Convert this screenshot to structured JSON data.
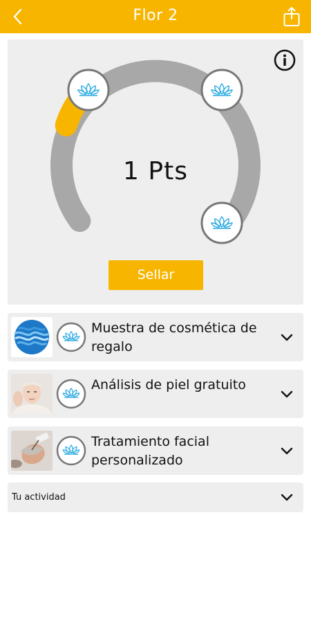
{
  "header": {
    "title": "Flor 2",
    "back_icon": "chevron-left-icon",
    "share_icon": "share-icon",
    "background_color": "#f7b500"
  },
  "stamp_card": {
    "points_label": "1 Pts",
    "points": 1,
    "progress_fraction": 0.1,
    "milestone_icon": "lotus-icon",
    "info_icon": "info-icon",
    "stamp_button_label": "Sellar",
    "track_color": "#a8a8a8",
    "progress_color": "#f7b500",
    "lotus_color": "#29a9e1"
  },
  "rewards": [
    {
      "label": "Muestra de cosmética de regalo",
      "thumbnail": "blue-waves-image",
      "badge_icon": "lotus-icon",
      "expand_icon": "chevron-down-icon"
    },
    {
      "label": "Análisis de piel gratuito",
      "thumbnail": "woman-skin-image",
      "badge_icon": "lotus-icon",
      "expand_icon": "chevron-down-icon"
    },
    {
      "label": "Tratamiento facial personalizado",
      "thumbnail": "facial-treatment-image",
      "badge_icon": "lotus-icon",
      "expand_icon": "chevron-down-icon"
    }
  ],
  "activity": {
    "label": "Tu actividad",
    "expand_icon": "chevron-down-icon"
  }
}
